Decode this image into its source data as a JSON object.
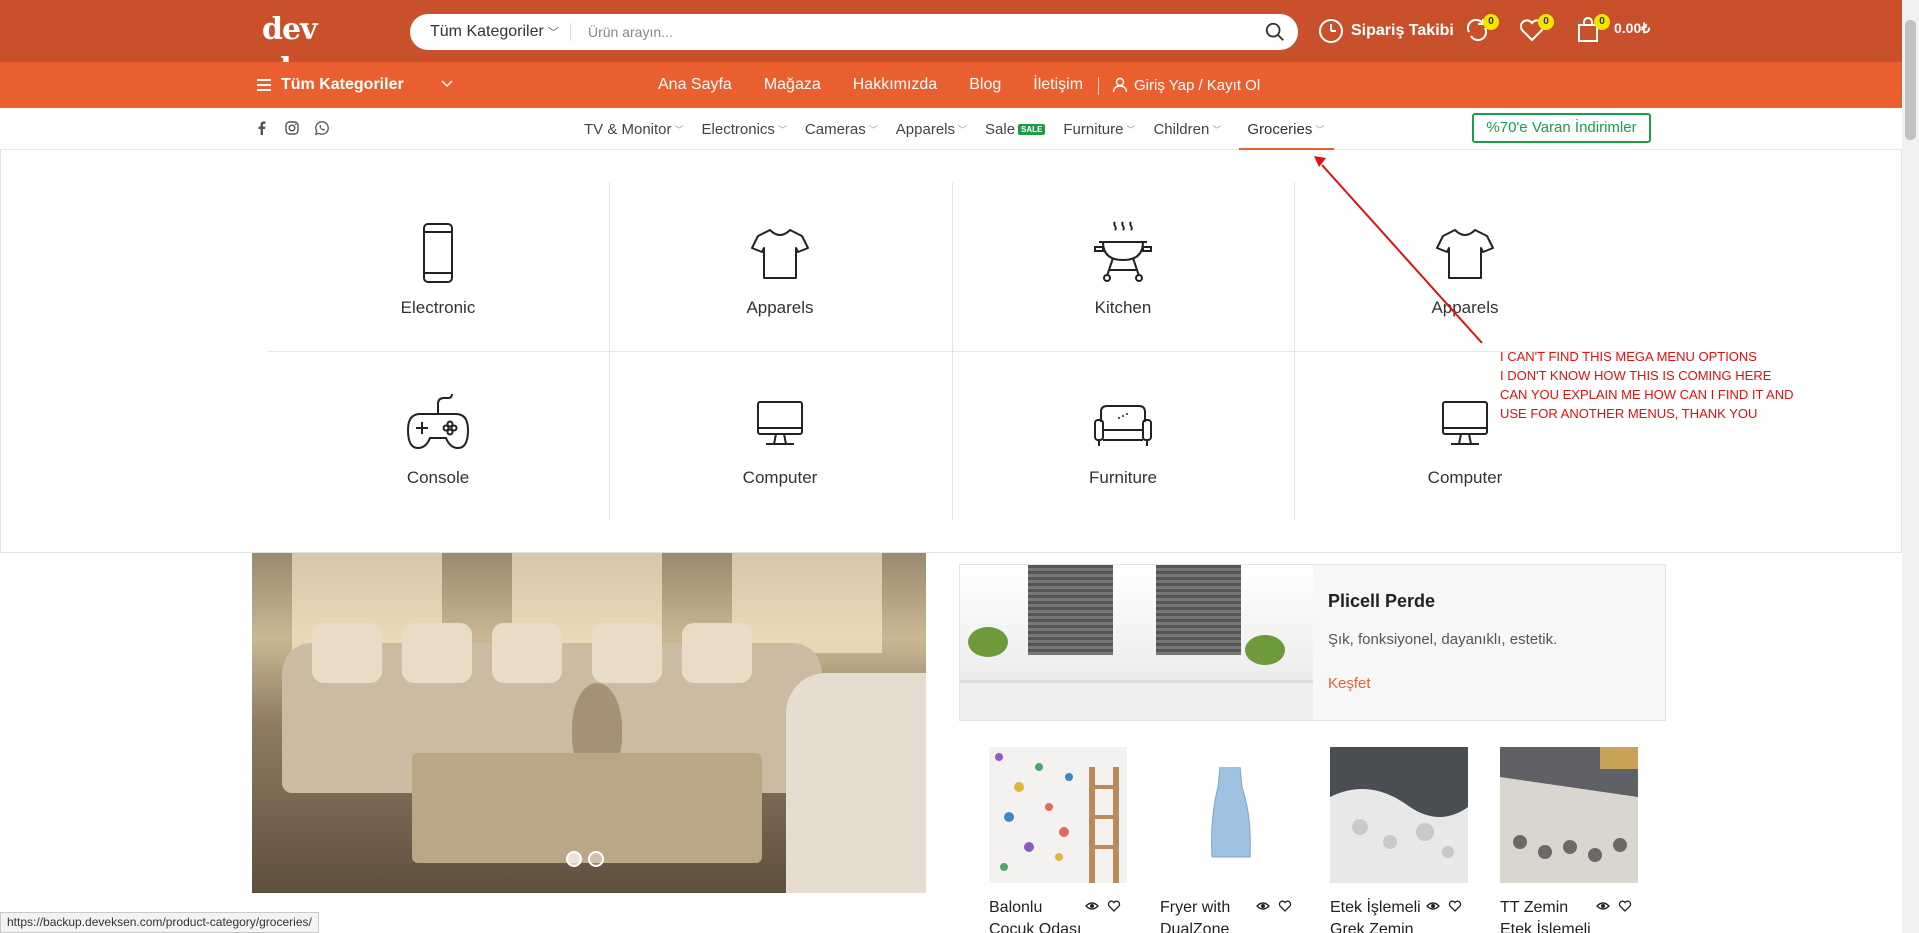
{
  "header": {
    "logo": "dev eksen",
    "search": {
      "category": "Tüm Kategoriler",
      "placeholder": "Ürün arayın..."
    },
    "order_tracking": "Sipariş Takibi",
    "compare_count": "0",
    "wishlist_count": "0",
    "cart_count": "0",
    "cart_total": "0.00₺"
  },
  "nav": {
    "all_categories": "Tüm Kategoriler",
    "links": [
      "Ana Sayfa",
      "Mağaza",
      "Hakkımızda",
      "Blog",
      "İletişim"
    ],
    "login": "Giriş Yap / Kayıt Ol"
  },
  "categories": {
    "items": [
      "TV & Monitor",
      "Electronics",
      "Cameras",
      "Apparels",
      "Sale",
      "Furniture",
      "Children",
      "Groceries"
    ],
    "sale_badge": "SALE",
    "promo": "%70'e Varan İndirimler"
  },
  "mega_menu": {
    "items": [
      {
        "label": "Electronic",
        "icon": "phone-icon"
      },
      {
        "label": "Apparels",
        "icon": "tshirt-icon"
      },
      {
        "label": "Kitchen",
        "icon": "grill-icon"
      },
      {
        "label": "Apparels",
        "icon": "tshirt-icon"
      },
      {
        "label": "Console",
        "icon": "gamepad-icon"
      },
      {
        "label": "Computer",
        "icon": "monitor-icon"
      },
      {
        "label": "Furniture",
        "icon": "sofa-icon"
      },
      {
        "label": "Computer",
        "icon": "monitor-icon"
      }
    ]
  },
  "annotation": {
    "text": "I CAN'T FIND THIS MEGA MENU OPTIONS\nI DON'T KNOW HOW THIS IS COMING HERE\nCAN YOU EXPLAIN ME HOW CAN I FIND IT AND\nUSE FOR ANOTHER MENUS, THANK YOU",
    "color": "#e01010"
  },
  "promo_card": {
    "title": "Plicell Perde",
    "description": "Şık, fonksiyonel, dayanıklı, estetik.",
    "link": "Keşfet"
  },
  "products": [
    {
      "name_line1": "Balonlu",
      "name_line2": "Çocuk Odası"
    },
    {
      "name_line1": "Fryer with",
      "name_line2": "DualZone"
    },
    {
      "name_line1": "Etek İşlemeli",
      "name_line2": "Grek Zemin"
    },
    {
      "name_line1": "TT Zemin",
      "name_line2": "Etek İşlemeli"
    }
  ],
  "status_url": "https://backup.deveksen.com/product-category/groceries/",
  "colors": {
    "brand_dark": "#c8502a",
    "brand": "#ea5f2f",
    "green": "#1e9c46",
    "badge": "#f2e600"
  }
}
